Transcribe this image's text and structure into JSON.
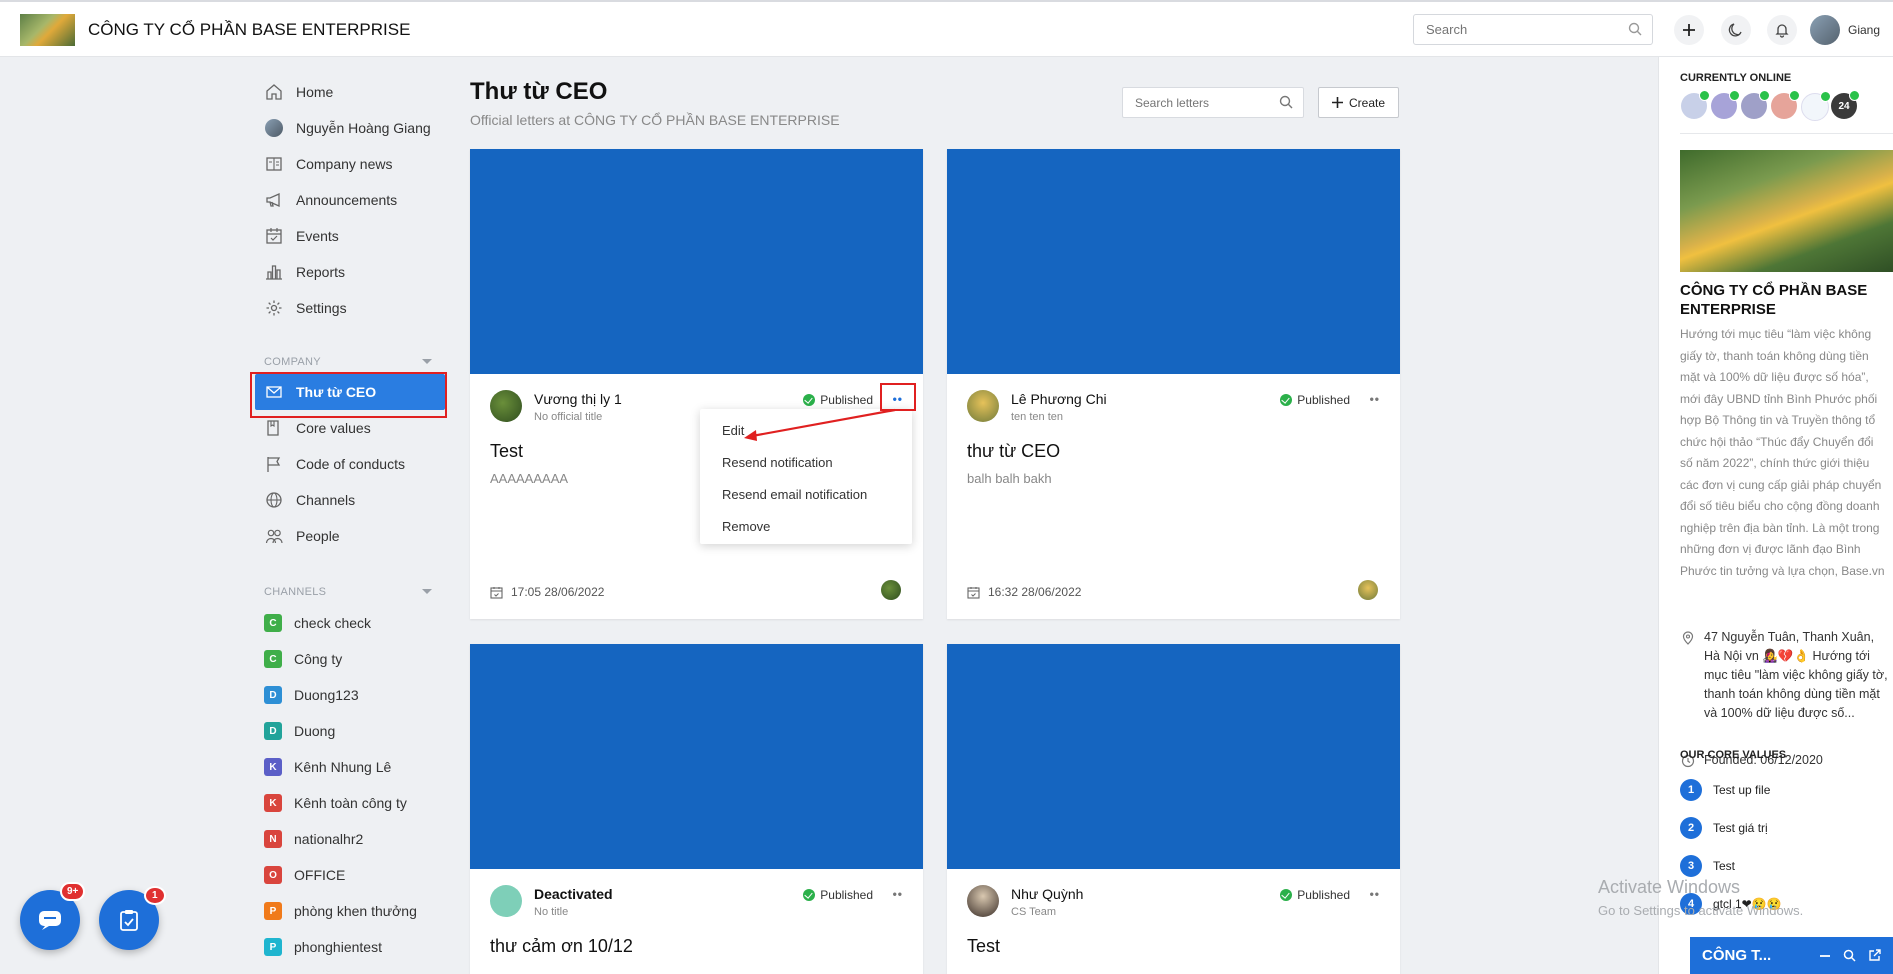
{
  "header": {
    "company_name": "CÔNG TY CỔ PHẦN BASE ENTERPRISE",
    "search_placeholder": "Search",
    "username": "Giang"
  },
  "sidebar": {
    "nav": [
      {
        "label": "Home",
        "icon": "home-icon"
      },
      {
        "label": "Nguyễn Hoàng Giang",
        "icon": "user-avatar"
      },
      {
        "label": "Company news",
        "icon": "newspaper-icon"
      },
      {
        "label": "Announcements",
        "icon": "megaphone-icon"
      },
      {
        "label": "Events",
        "icon": "calendar-check-icon"
      },
      {
        "label": "Reports",
        "icon": "bar-chart-icon"
      },
      {
        "label": "Settings",
        "icon": "gear-icon"
      }
    ],
    "company_heading": "COMPANY",
    "company_items": [
      {
        "label": "Thư từ CEO",
        "icon": "mail-icon"
      },
      {
        "label": "Core values",
        "icon": "book-icon"
      },
      {
        "label": "Code of conducts",
        "icon": "flag-icon"
      },
      {
        "label": "Channels",
        "icon": "globe-icon"
      },
      {
        "label": "People",
        "icon": "people-icon"
      }
    ],
    "channels_heading": "CHANNELS",
    "channels": [
      {
        "letter": "C",
        "label": "check check",
        "color": "#3fae49"
      },
      {
        "letter": "C",
        "label": "Công ty",
        "color": "#3fae49"
      },
      {
        "letter": "D",
        "label": "Duong123",
        "color": "#2d8fd5"
      },
      {
        "letter": "D",
        "label": "Duong",
        "color": "#21a39a"
      },
      {
        "letter": "K",
        "label": "Kênh Nhung Lê",
        "color": "#5b5fc7"
      },
      {
        "letter": "K",
        "label": "Kênh toàn công ty",
        "color": "#d9453d"
      },
      {
        "letter": "N",
        "label": "nationalhr2",
        "color": "#d9453d"
      },
      {
        "letter": "O",
        "label": "OFFICE",
        "color": "#d9453d"
      },
      {
        "letter": "P",
        "label": "phòng khen thưởng",
        "color": "#f07a1a"
      },
      {
        "letter": "P",
        "label": "phonghientest",
        "color": "#1fb5cf"
      }
    ]
  },
  "main": {
    "title": "Thư từ CEO",
    "subtitle": "Official letters at CÔNG TY CỔ PHẦN BASE ENTERPRISE",
    "search_placeholder": "Search letters",
    "create_label": "Create",
    "letters": [
      {
        "author": "Vương thị ly 1",
        "author_sub": "No official title",
        "status": "Published",
        "title": "Test",
        "body": "AAAAAAAAA",
        "date": "17:05 28/06/2022"
      },
      {
        "author": "Lê Phương Chi",
        "author_sub": "ten ten ten",
        "status": "Published",
        "title": "thư từ CEO",
        "body": "balh balh bakh",
        "date": "16:32 28/06/2022"
      },
      {
        "author": "Deactivated",
        "author_sub": "No title",
        "status": "Published",
        "title": "thư cảm ơn 10/12",
        "body": "",
        "date": ""
      },
      {
        "author": "Như Quỳnh",
        "author_sub": "CS Team",
        "status": "Published",
        "title": "Test",
        "body": "",
        "date": ""
      }
    ],
    "menu": [
      "Edit",
      "Resend notification",
      "Resend email notification",
      "Remove"
    ]
  },
  "right_panel": {
    "online_heading": "CURRENTLY ONLINE",
    "online_more": "24",
    "company_name": "CÔNG TY CỔ PHẦN BASE ENTERPRISE",
    "description": "Hướng tới mục tiêu “làm việc không giấy tờ, thanh toán không dùng tiền mặt và 100% dữ liệu được số hóa”, mới đây UBND tỉnh Bình Phước phối hợp Bộ Thông tin và Truyền thông tổ chức hội thảo “Thúc đẩy Chuyển đổi số năm 2022”, chính thức giới thiệu các đơn vị cung cấp giải pháp chuyển đổi số tiêu biểu cho cộng đồng doanh nghiệp trên địa bàn tỉnh. Là một trong những đơn vị được lãnh đạo Bình Phước tin tưởng và lựa chọn, Base.vn thu hút sự quan tâm của nhiều doanh nghiệp SMEs. Theo...",
    "address": "47 Nguyễn Tuân, Thanh Xuân, Hà Nội vn 👩‍🎤💔👌 Hướng tới mục tiêu \"làm việc không giấy tờ, thanh toán không dùng tiền mặt và 100% dữ liệu được số...",
    "founded": "Founded: 06/12/2020",
    "core_heading": "OUR CORE VALUES",
    "core_values": [
      "Test up file",
      "Test giá trị",
      "Test",
      "gtcl 1❤😢😢"
    ],
    "chat_label": "CÔNG T..."
  },
  "overlay": {
    "activate_title": "Activate Windows",
    "activate_sub": "Go to Settings to activate Windows."
  },
  "fabs": {
    "chat_badge": "9+",
    "tasks_badge": "1"
  }
}
